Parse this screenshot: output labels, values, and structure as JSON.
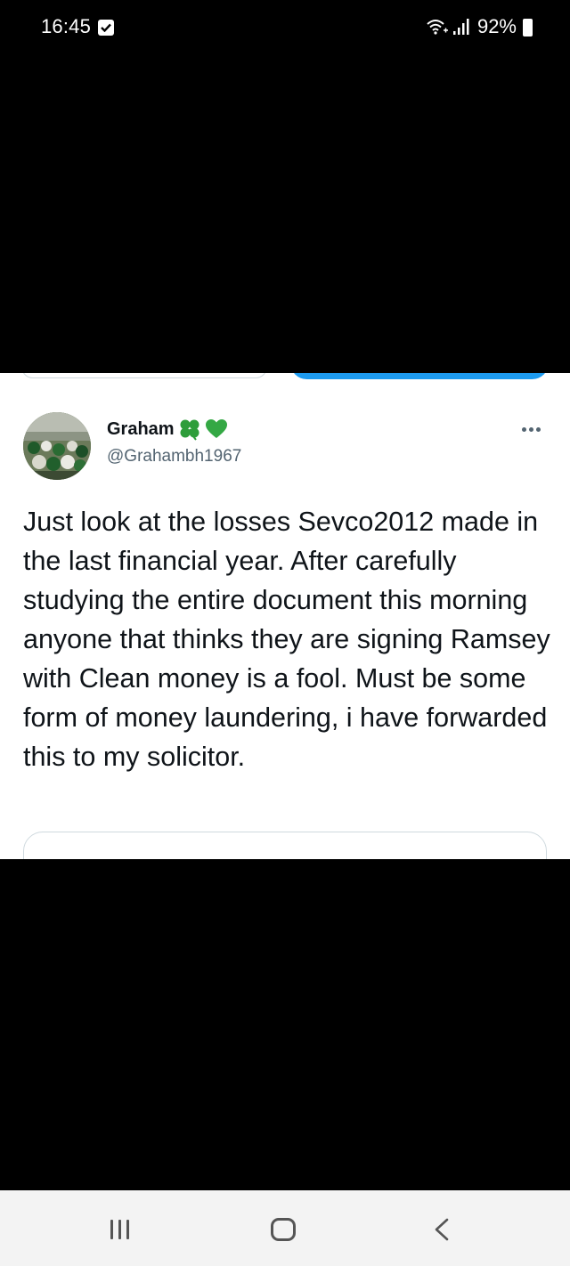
{
  "status_bar": {
    "time": "16:45",
    "battery": "92%",
    "notification_icon": "checkbox-icon",
    "wifi_icon": "wifi-icon",
    "signal_icon": "signal-icon"
  },
  "tweet": {
    "display_name": "Graham",
    "name_emojis": [
      "shamrock-icon",
      "green-heart-icon"
    ],
    "handle": "@Grahambh1967",
    "text": "Just look at the losses Sevco2012 made in the last financial year. After carefully studying the entire document this morning anyone that thinks they are signing Ramsey with Clean money is a fool. Must be some form of money laundering, i have forwarded this to my solicitor.",
    "more_icon": "more-options-icon"
  },
  "colors": {
    "accent_blue": "#1d9bf0",
    "emoji_green": "#2e9d3a",
    "text_primary": "#0f1419",
    "text_secondary": "#536471"
  },
  "nav_bar": {
    "recents_icon": "recents-icon",
    "home_icon": "home-icon",
    "back_icon": "back-icon"
  }
}
